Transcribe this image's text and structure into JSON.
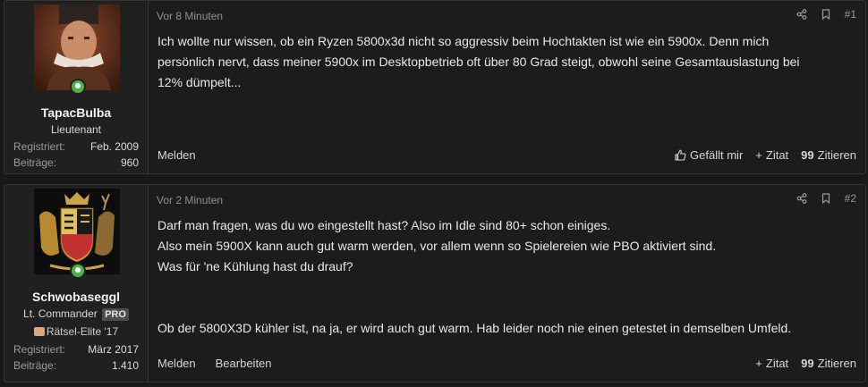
{
  "posts": [
    {
      "time": "Vor 8 Minuten",
      "number": "#1",
      "user": {
        "name": "TapacBulba",
        "title": "Lieutenant",
        "stats": [
          {
            "label": "Registriert:",
            "value": "Feb. 2009"
          },
          {
            "label": "Beiträge:",
            "value": "960"
          }
        ]
      },
      "lines": [
        "Ich wollte nur wissen, ob ein Ryzen 5800x3d nicht so aggressiv beim Hochtakten ist wie ein 5900x. Denn mich",
        "persönlich nervt, dass meiner 5900x im Desktopbetrieb oft über 80 Grad steigt, obwohl seine Gesamtauslastung bei",
        "12% dümpelt..."
      ],
      "actions_left": [
        "Melden"
      ],
      "actions_right": [
        "Gefällt mir",
        "Zitat",
        "Zitieren"
      ]
    },
    {
      "time": "Vor 2 Minuten",
      "number": "#2",
      "user": {
        "name": "Schwobaseggl",
        "title": "Lt. Commander",
        "pro": "PRO",
        "badge": "Rätsel-Elite '17",
        "stats": [
          {
            "label": "Registriert:",
            "value": "März 2017"
          },
          {
            "label": "Beiträge:",
            "value": "1.410"
          }
        ]
      },
      "lines": [
        "Darf man fragen, was du wo eingestellt hast? Also im Idle sind 80+ schon einiges.",
        "Also mein 5900X kann auch gut warm werden, vor allem wenn so Spielereien wie PBO aktiviert sind.",
        "Was für 'ne Kühlung hast du drauf?",
        "Ob der 5800X3D kühler ist, na ja, er wird auch gut warm. Hab leider noch nie einen getestet in demselben Umfeld."
      ],
      "actions_left": [
        "Melden",
        "Bearbeiten"
      ],
      "actions_right": [
        "Zitat",
        "Zitieren"
      ]
    }
  ],
  "colors": {
    "online": "#52b24a",
    "background": "#181818",
    "panel": "#1c1c1c"
  }
}
